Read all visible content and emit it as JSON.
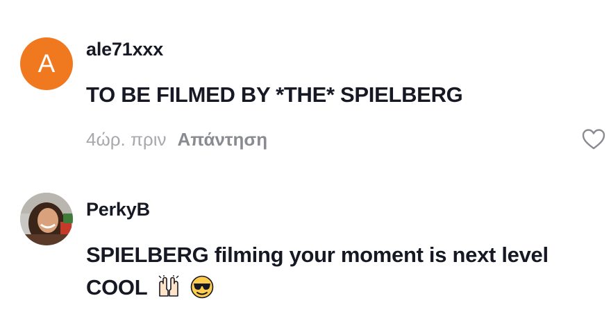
{
  "comments": [
    {
      "username": "ale71xxx",
      "avatar_letter": "A",
      "avatar_color": "#f0781f",
      "text": "TO BE FILMED BY *THE* SPIELBERG",
      "time": "4ώρ. πριν",
      "reply_label": "Απάντηση",
      "like_icon": "heart-outline-icon"
    },
    {
      "username": "PerkyB",
      "avatar": "profile-photo",
      "text": "SPIELBERG filming your moment is next level COOL",
      "emojis": [
        "raising-hands-emoji",
        "smiling-face-with-sunglasses-emoji"
      ]
    }
  ]
}
